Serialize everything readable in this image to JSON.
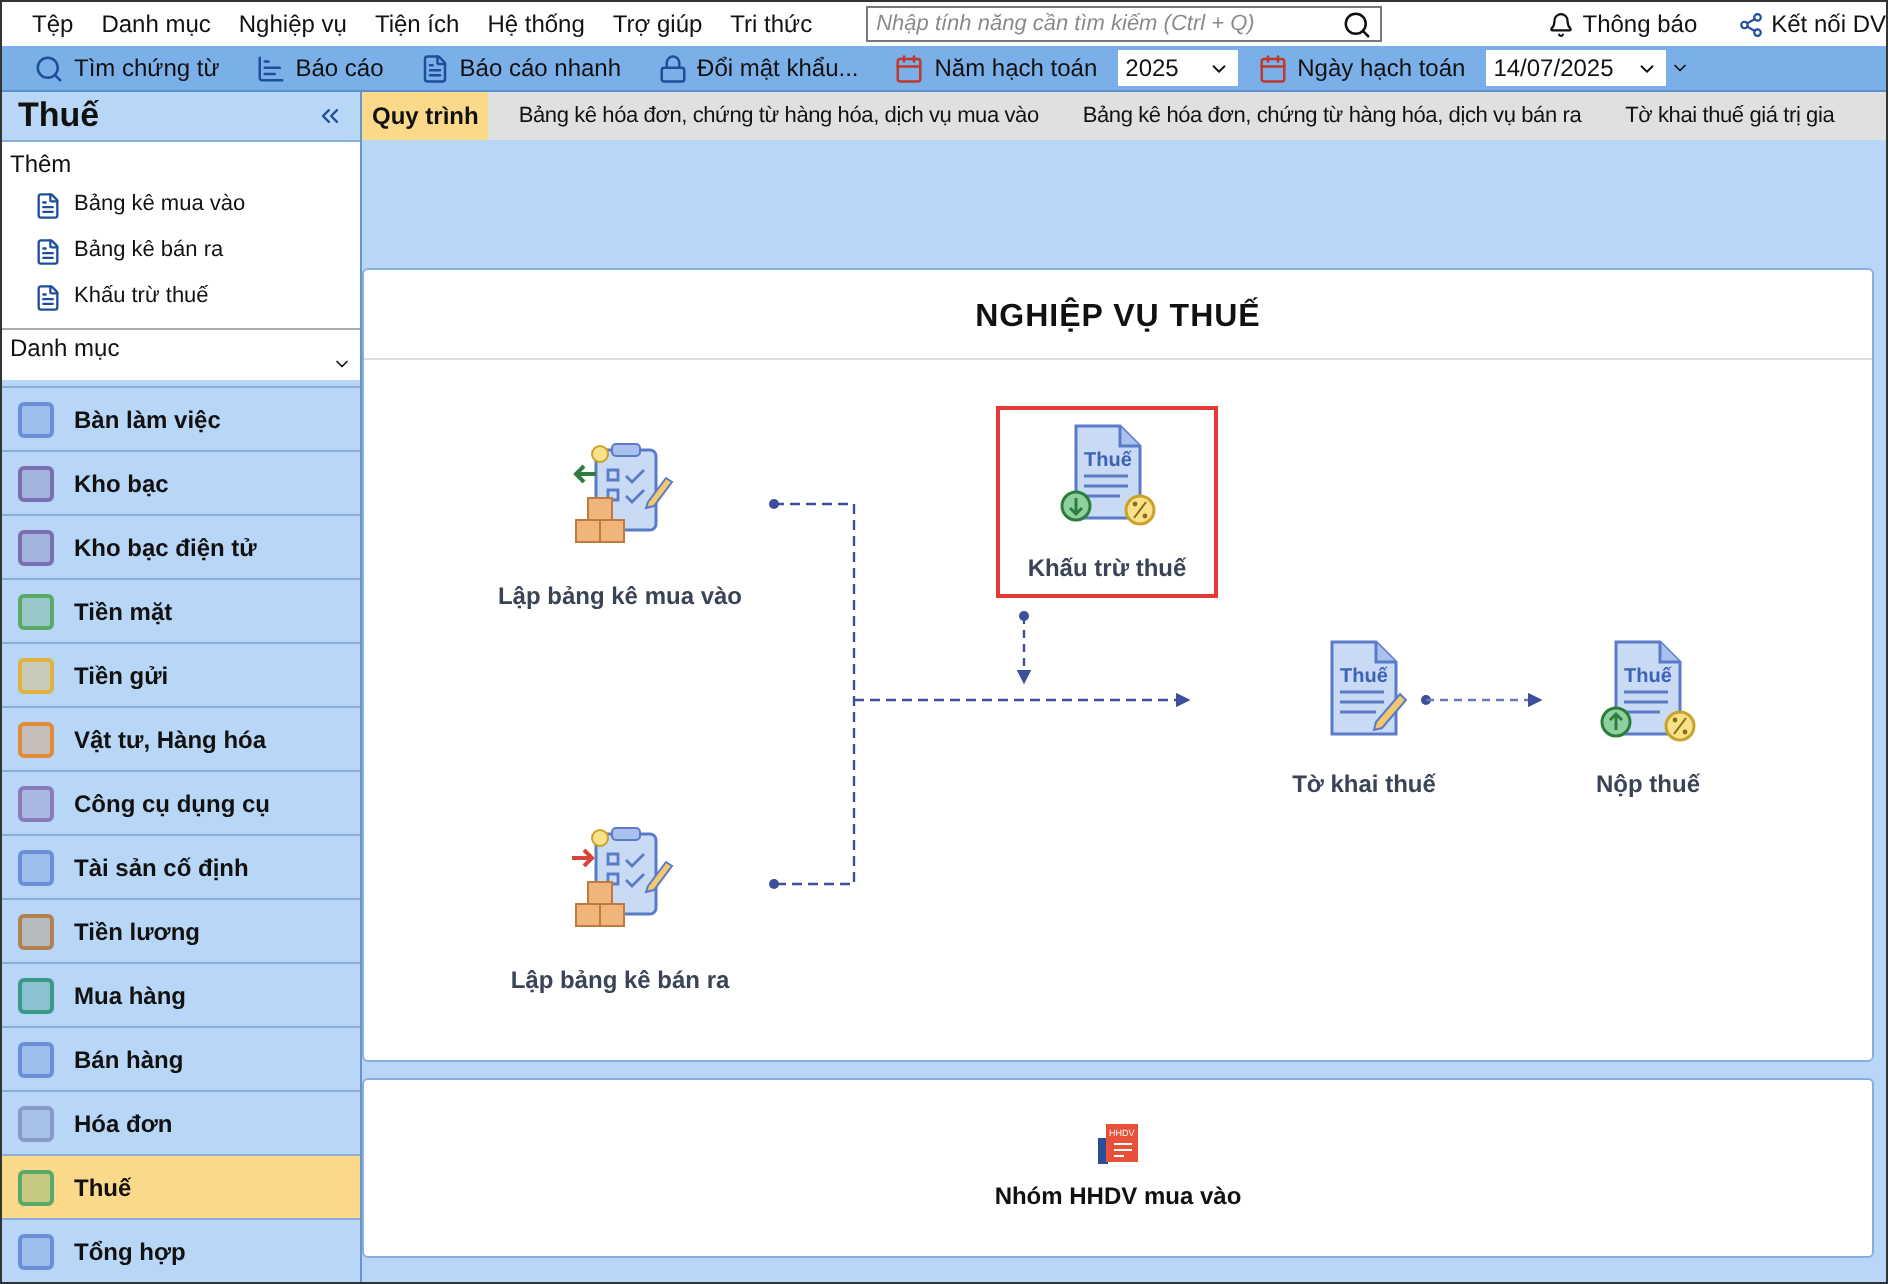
{
  "menu": [
    "Tệp",
    "Danh mục",
    "Nghiệp vụ",
    "Tiện ích",
    "Hệ thống",
    "Trợ giúp",
    "Tri thức"
  ],
  "search": {
    "placeholder": "Nhập tính năng cần tìm kiếm (Ctrl + Q)"
  },
  "header_right": [
    {
      "kind": "bell",
      "label": "Thông báo"
    },
    {
      "kind": "connect",
      "label": "Kết nối DV"
    }
  ],
  "toolbar": [
    {
      "kind": "search",
      "label": "Tìm chứng từ"
    },
    {
      "kind": "report",
      "label": "Báo cáo"
    },
    {
      "kind": "quick",
      "label": "Báo cáo nhanh"
    },
    {
      "kind": "lock",
      "label": "Đổi mật khẩu..."
    }
  ],
  "year": {
    "label": "Năm hạch toán",
    "value": "2025"
  },
  "date": {
    "label": "Ngày hạch toán",
    "value": "14/07/2025"
  },
  "sidebar": {
    "title": "Thuế",
    "add_section": {
      "title": "Thêm",
      "items": [
        "Bảng kê mua vào",
        "Bảng kê bán ra",
        "Khấu trừ thuế"
      ]
    },
    "catalog": {
      "title": "Danh mục"
    },
    "nav": [
      {
        "kind": "desk",
        "label": "Bàn làm việc",
        "selected": false
      },
      {
        "kind": "bank",
        "label": "Kho bạc",
        "selected": false
      },
      {
        "kind": "bank",
        "label": "Kho bạc điện tử",
        "selected": false
      },
      {
        "kind": "cash",
        "label": "Tiền mặt",
        "selected": false
      },
      {
        "kind": "deposit",
        "label": "Tiền gửi",
        "selected": false
      },
      {
        "kind": "box",
        "label": "Vật tư, Hàng hóa",
        "selected": false
      },
      {
        "kind": "tool",
        "label": "Công cụ dụng cụ",
        "selected": false
      },
      {
        "kind": "asset",
        "label": "Tài sản cố định",
        "selected": false
      },
      {
        "kind": "salary",
        "label": "Tiền lương",
        "selected": false
      },
      {
        "kind": "cart",
        "label": "Mua hàng",
        "selected": false
      },
      {
        "kind": "sale",
        "label": "Bán hàng",
        "selected": false
      },
      {
        "kind": "invoice",
        "label": "Hóa đơn",
        "selected": false
      },
      {
        "kind": "tax",
        "label": "Thuế",
        "selected": true
      },
      {
        "kind": "summary",
        "label": "Tổng hợp",
        "selected": false
      }
    ]
  },
  "tabs": [
    {
      "label": "Quy trình",
      "selected": true
    },
    {
      "label": "Bảng kê hóa đơn, chứng từ hàng hóa, dịch vụ mua vào",
      "selected": false
    },
    {
      "label": "Bảng kê hóa đơn, chứng từ hàng hóa, dịch vụ bán ra",
      "selected": false
    },
    {
      "label": "Tờ khai thuế giá trị gia",
      "selected": false
    }
  ],
  "process": {
    "title": "NGHIỆP VỤ THUẾ",
    "nodes": [
      {
        "kind": "purchase",
        "label": "Lập bảng kê mua vào",
        "selected": false
      },
      {
        "kind": "deduct",
        "label": "Khấu trừ thuế",
        "icon_text": "Thuế",
        "selected": true
      },
      {
        "kind": "declare",
        "label": "Tờ khai thuế",
        "icon_text": "Thuế",
        "selected": false
      },
      {
        "kind": "pay",
        "label": "Nộp thuế",
        "icon_text": "Thuế",
        "selected": false
      },
      {
        "kind": "sale",
        "label": "Lập bảng kê bán ra",
        "selected": false
      }
    ]
  },
  "group": {
    "label": "Nhóm HHDV mua vào",
    "icon_text": "HHDV"
  }
}
